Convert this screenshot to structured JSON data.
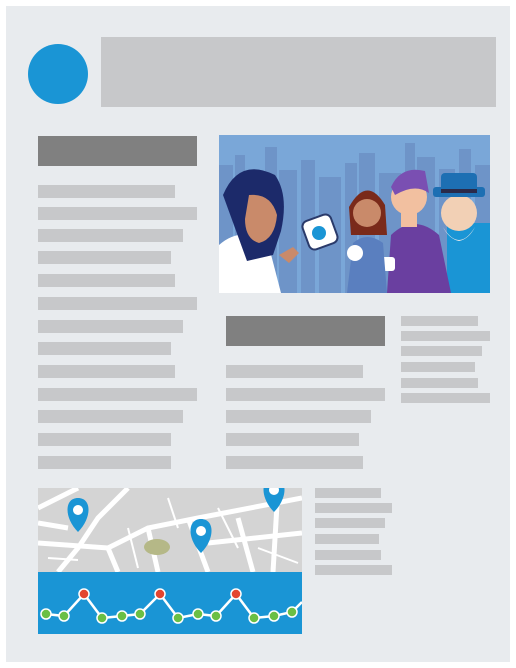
{
  "colors": {
    "accent": "#1a95d5",
    "page": "#e8ebee",
    "placeholder_light": "#c7c8ca",
    "placeholder_dark": "#808080",
    "map_land": "#d4d4d4",
    "map_roads": "#ffffff",
    "sky": "#7aa7d8",
    "skyline": "#6e94c8",
    "marker_point": "#e3452f",
    "marker_green": "#6abf45"
  },
  "icons": {
    "logo": "circle-logo-icon",
    "map_pins": [
      "map-pin-icon",
      "map-pin-icon",
      "map-pin-icon"
    ]
  },
  "illustration": {
    "subject": "group-of-people-illustration"
  },
  "chart_strip": {
    "levels": [
      0.3,
      0.8,
      0.25,
      0.3,
      0.8,
      0.3,
      0.8,
      0.2,
      0.3
    ]
  }
}
